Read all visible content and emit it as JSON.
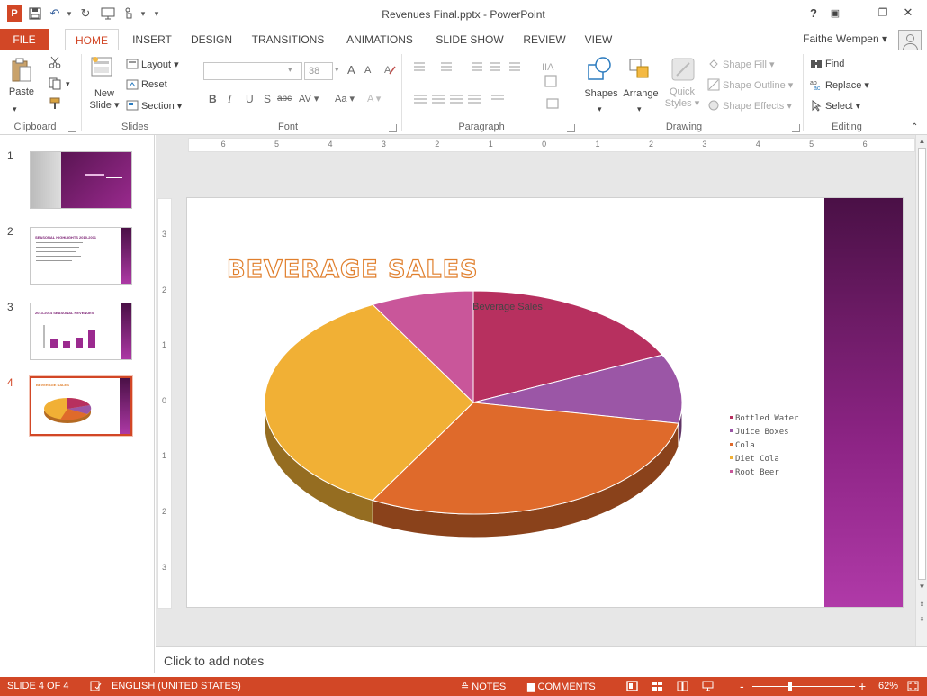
{
  "window": {
    "title": "Revenues Final.pptx - PowerPoint",
    "help": "?",
    "restore_ribbon": "▣",
    "minimize": "–",
    "maximize": "❐",
    "close": "✕"
  },
  "qat": {
    "logo": "P",
    "undo": "↶",
    "redo": "↻",
    "customize": "▾"
  },
  "tabs": [
    {
      "label": "FILE"
    },
    {
      "label": "HOME"
    },
    {
      "label": "INSERT"
    },
    {
      "label": "DESIGN"
    },
    {
      "label": "TRANSITIONS"
    },
    {
      "label": "ANIMATIONS"
    },
    {
      "label": "SLIDE SHOW"
    },
    {
      "label": "REVIEW"
    },
    {
      "label": "VIEW"
    }
  ],
  "user": {
    "name": "Faithe Wempen ▾"
  },
  "ribbon": {
    "clipboard": {
      "label": "Clipboard",
      "paste": "Paste"
    },
    "slides": {
      "label": "Slides",
      "new_slide": "New Slide ▾",
      "layout": "Layout ▾",
      "reset": "Reset",
      "section": "Section ▾"
    },
    "font": {
      "label": "Font",
      "font_size": "38",
      "bold": "B",
      "italic": "I",
      "underline": "U",
      "shadow": "S",
      "strike": "abc",
      "spacing": "AV ▾",
      "case": "Aa ▾",
      "grow": "A",
      "shrink": "A",
      "clear": "A",
      "color": "A ▾"
    },
    "paragraph": {
      "label": "Paragraph"
    },
    "drawing": {
      "label": "Drawing",
      "shapes": "Shapes",
      "arrange": "Arrange",
      "quick_styles": "Quick Styles ▾",
      "shape_fill": "Shape Fill ▾",
      "shape_outline": "Shape Outline ▾",
      "shape_effects": "Shape Effects ▾"
    },
    "editing": {
      "label": "Editing",
      "find": "Find",
      "replace": "Replace ▾",
      "select": "Select ▾"
    }
  },
  "thumbnails": [
    {
      "num": "1"
    },
    {
      "num": "2",
      "title": "SEASONAL HIGHLIGHTS 2010-2011"
    },
    {
      "num": "3",
      "title": "2013-2014 SEASONAL REVENUES"
    },
    {
      "num": "4",
      "title": "BEVERAGE SALES"
    }
  ],
  "ruler": {
    "h_labels": [
      "6",
      "5",
      "4",
      "3",
      "2",
      "1",
      "0",
      "1",
      "2",
      "3",
      "4",
      "5",
      "6"
    ],
    "v_labels": [
      "3",
      "2",
      "1",
      "0",
      "1",
      "2",
      "3"
    ]
  },
  "slide": {
    "title": "BEVERAGE SALES"
  },
  "chart_data": {
    "type": "pie",
    "title": "Beverage Sales",
    "legend_position": "right",
    "categories": [
      "Bottled Water",
      "Juice Boxes",
      "Cola",
      "Diet Cola",
      "Root Beer"
    ],
    "values": [
      18,
      10,
      30,
      34,
      8
    ],
    "colors": [
      "#b7305f",
      "#9b56a6",
      "#df6a2b",
      "#f1b035",
      "#c9569a"
    ],
    "style": "3d"
  },
  "notes": {
    "placeholder": "Click to add notes"
  },
  "statusbar": {
    "slide_info": "SLIDE 4 OF 4",
    "language": "ENGLISH (UNITED STATES)",
    "notes": "NOTES",
    "comments": "COMMENTS",
    "zoom_minus": "-",
    "zoom_plus": "+",
    "zoom": "62%"
  },
  "colors": {
    "accent": "#d24726",
    "slide_band": "#7a1f72"
  }
}
